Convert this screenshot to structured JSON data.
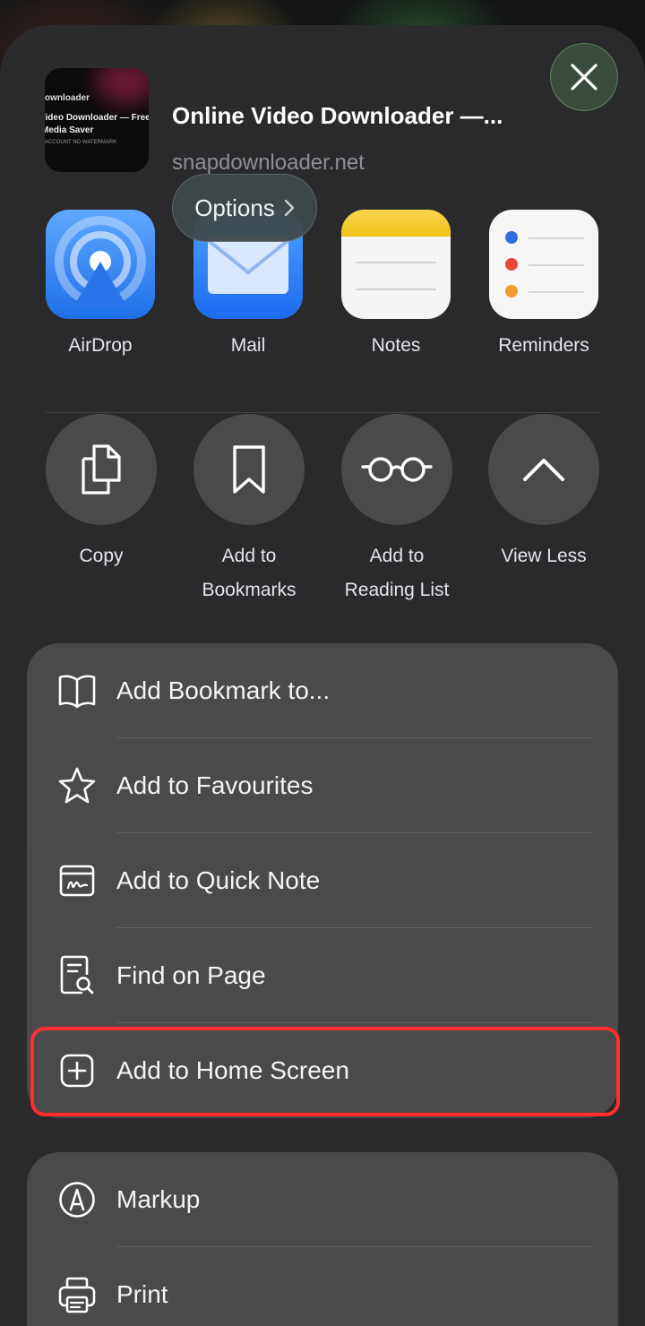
{
  "header": {
    "thumbnail_line1": "ownloader",
    "thumbnail_line2": "Video Downloader — Free",
    "thumbnail_line3": "Media Saver",
    "thumbnail_line4": "ACCOUNT   NO WATERMARK",
    "title": "Online Video Downloader —...",
    "domain": "snapdownloader.net",
    "options_label": "Options"
  },
  "apps": [
    {
      "label": "AirDrop",
      "icon": "airdrop-icon"
    },
    {
      "label": "Mail",
      "icon": "mail-icon"
    },
    {
      "label": "Notes",
      "icon": "notes-icon"
    },
    {
      "label": "Reminders",
      "icon": "reminders-icon"
    }
  ],
  "actions": [
    {
      "line1": "Copy",
      "line2": "",
      "icon": "copy-icon"
    },
    {
      "line1": "Add to",
      "line2": "Bookmarks",
      "icon": "bookmark-icon"
    },
    {
      "line1": "Add to",
      "line2": "Reading List",
      "icon": "glasses-icon"
    },
    {
      "line1": "View Less",
      "line2": "",
      "icon": "chevron-up-icon"
    }
  ],
  "menu": [
    {
      "label": "Add Bookmark to...",
      "icon": "book-icon"
    },
    {
      "label": "Add to Favourites",
      "icon": "star-icon"
    },
    {
      "label": "Add to Quick Note",
      "icon": "quick-note-icon"
    },
    {
      "label": "Find on Page",
      "icon": "find-on-page-icon"
    },
    {
      "label": "Add to Home Screen",
      "icon": "plus-square-icon",
      "highlighted": true
    }
  ],
  "menu2": [
    {
      "label": "Markup",
      "icon": "markup-icon"
    },
    {
      "label": "Print",
      "icon": "printer-icon"
    }
  ],
  "colors": {
    "highlight": "#ff2d2d",
    "sheet": "#2c2c2e",
    "group": "#4a4a4d"
  }
}
